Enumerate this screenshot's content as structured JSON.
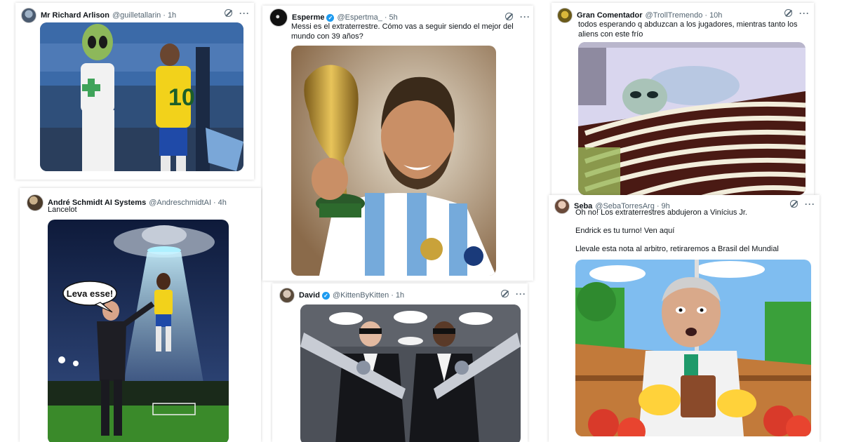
{
  "tweets": [
    {
      "name": "Mr Richard Arlison",
      "handle": "@guilletallarin",
      "time": "1h",
      "text": [],
      "avatar_color": "#6b7a8f",
      "media_icon": "alien-neymar-photo"
    },
    {
      "name": "Esperme",
      "handle": "@Espertma_",
      "time": "5h",
      "text": [
        "Messi es el extraterrestre. Cómo vas a seguir siendo el mejor del mundo con 39 años?"
      ],
      "avatar_color": "#1a1a1a",
      "media_icon": "messi-world-cup-photo"
    },
    {
      "name": "Gran Comentador",
      "handle": "@TrollTremendo",
      "time": "10h",
      "text": [
        "todos esperando q abduzcan a los jugadores, mientras tanto los aliens con este frío"
      ],
      "avatar_color": "#8a7a2a",
      "media_icon": "alien-in-bed-photo"
    },
    {
      "name": "André Schmidt AI Systems",
      "handle": "@AndreschmidtAI",
      "time": "4h",
      "text": [
        "Lancelot"
      ],
      "avatar_color": "#5a3b2b",
      "media_icon": "ufo-abduction-illustration",
      "bubble": "Leva esse!"
    },
    {
      "name": "David",
      "handle": "@KittenByKitten",
      "time": "1h",
      "text": [],
      "avatar_color": "#7a6a5a",
      "media_icon": "men-in-black-photo"
    },
    {
      "name": "Seba",
      "handle": "@SebaTorresArg",
      "time": "9h",
      "text": [
        "Oh no! Los extraterrestres abdujeron a Vinícius Jr.",
        "Endrick es tu turno! Ven aquí",
        "Llevale esta nota al arbitro, retiraremos a Brasil del Mundial"
      ],
      "avatar_color": "#8a6a5a",
      "media_icon": "simpsons-cartoon-meme"
    }
  ],
  "colors": {
    "text": "#0f1419",
    "muted": "#536471",
    "verified": "#1d9bf0"
  }
}
